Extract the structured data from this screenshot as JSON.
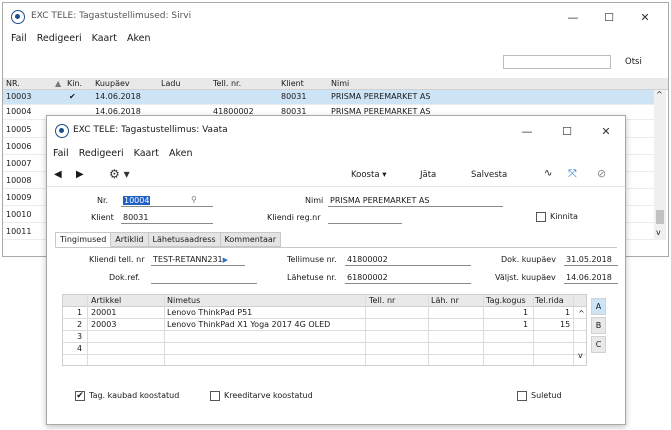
{
  "back_window": {
    "title": "EXC TELE: Tagastustellimused: Sirvi",
    "menu": [
      "Fail",
      "Redigeeri",
      "Kaart",
      "Aken"
    ],
    "search_button": "Otsi",
    "columns": [
      "NR.",
      "Kin.",
      "Kuupäev",
      "Ladu",
      "Tell. nr.",
      "Klient",
      "Nimi"
    ],
    "rows": [
      {
        "nr": "10003",
        "kin": "✔",
        "date": "14.06.2018",
        "ladu": "",
        "tell": "",
        "klient": "80031",
        "nimi": "PRISMA PEREMARKET AS"
      },
      {
        "nr": "10004",
        "kin": "",
        "date": "14.06.2018",
        "ladu": "",
        "tell": "41800002",
        "klient": "80031",
        "nimi": "PRISMA PEREMARKET AS"
      },
      {
        "nr": "10005"
      },
      {
        "nr": "10006"
      },
      {
        "nr": "10007"
      },
      {
        "nr": "10008"
      },
      {
        "nr": "10009"
      },
      {
        "nr": "10010"
      },
      {
        "nr": "10011"
      }
    ]
  },
  "front_window": {
    "title": "EXC TELE: Tagastustellimus: Vaata",
    "menu": [
      "Fail",
      "Redigeeri",
      "Kaart",
      "Aken"
    ],
    "toolbar": {
      "koosta": "Koosta",
      "jata": "Jäta",
      "salvesta": "Salvesta"
    },
    "header": {
      "nr_label": "Nr.",
      "nr_value": "10004",
      "nimi_label": "Nimi",
      "nimi_value": "PRISMA PEREMARKET AS",
      "klient_label": "Klient",
      "klient_value": "80031",
      "regnr_label": "Kliendi reg.nr",
      "regnr_value": "",
      "kinnita_label": "Kinnita"
    },
    "tabs": [
      "Tingimused",
      "Artiklid",
      "Lähetusaadress",
      "Kommentaar"
    ],
    "terms": {
      "kliendi_tell_nr_label": "Kliendi tell. nr",
      "kliendi_tell_nr_value": "TEST-RETANN231",
      "tellimuse_nr_label": "Tellimuse nr.",
      "tellimuse_nr_value": "41800002",
      "dok_kuupaev_label": "Dok. kuupäev",
      "dok_kuupaev_value": "31.05.2018",
      "dok_ref_label": "Dok.ref.",
      "dok_ref_value": "",
      "lahetuse_nr_label": "Lähetuse nr.",
      "lahetuse_nr_value": "61800002",
      "valjst_kuupaev_label": "Väljst. kuupäev",
      "valjst_kuupaev_value": "14.06.2018"
    },
    "grid": {
      "columns": [
        "Artikkel",
        "Nimetus",
        "Tell. nr",
        "Läh. nr",
        "Tag.kogus",
        "Tel.rida"
      ],
      "rows": [
        {
          "n": "1",
          "artikkel": "20001",
          "nimetus": "Lenovo  ThinkPad P51",
          "tell": "",
          "lah": "",
          "kogus": "1",
          "rida": "1"
        },
        {
          "n": "2",
          "artikkel": "20003",
          "nimetus": "Lenovo  ThinkPad X1 Yoga 2017 4G OLED",
          "tell": "",
          "lah": "",
          "kogus": "1",
          "rida": "15"
        },
        {
          "n": "3"
        },
        {
          "n": "4"
        }
      ],
      "side_buttons": [
        "A",
        "B",
        "C"
      ]
    },
    "footer": {
      "tag_kaubad_label": "Tag. kaubad koostatud",
      "tag_kaubad_checked": "✔",
      "kreeditarve_label": "Kreeditarve koostatud",
      "suletud_label": "Suletud"
    }
  }
}
